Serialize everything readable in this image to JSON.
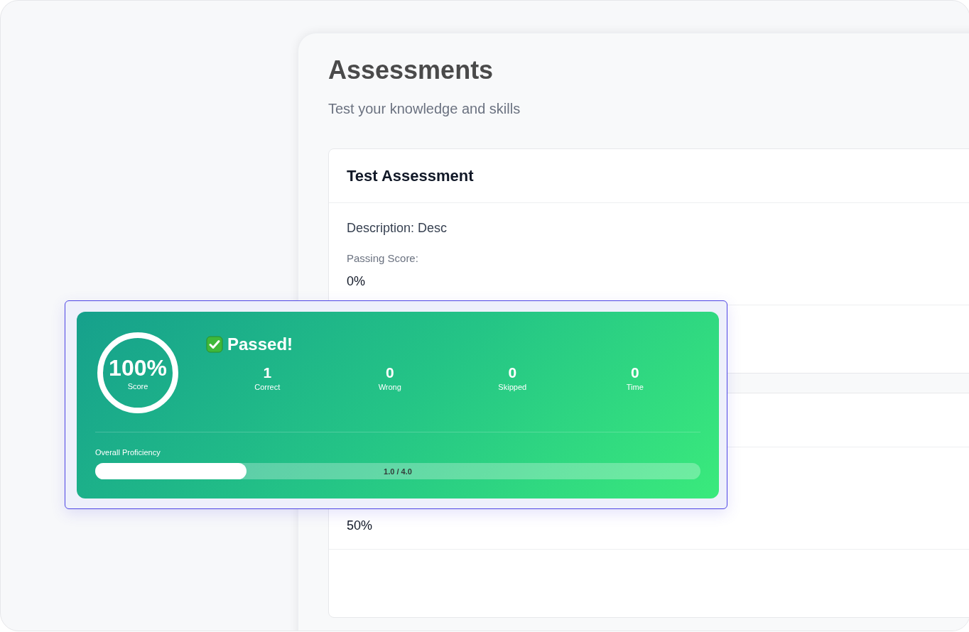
{
  "page": {
    "title": "Assessments",
    "subtitle": "Test your knowledge and skills"
  },
  "assessments": [
    {
      "title": "Test Assessment",
      "description": "Description: Desc",
      "fields": [
        {
          "label": "Passing Score:",
          "value": "0%"
        }
      ]
    },
    {
      "fields": [
        {
          "value": "50%"
        }
      ]
    }
  ],
  "result": {
    "passed": true,
    "heading": "Passed!",
    "score": "100%",
    "score_label": "Score",
    "stats": [
      {
        "value": "1",
        "label": "Correct"
      },
      {
        "value": "0",
        "label": "Wrong"
      },
      {
        "value": "0",
        "label": "Skipped"
      },
      {
        "value": "0",
        "label": "Time"
      }
    ],
    "proficiency": {
      "label": "Overall Proficiency",
      "level": 0.25,
      "reading": "1.0 / 4.0"
    }
  }
}
